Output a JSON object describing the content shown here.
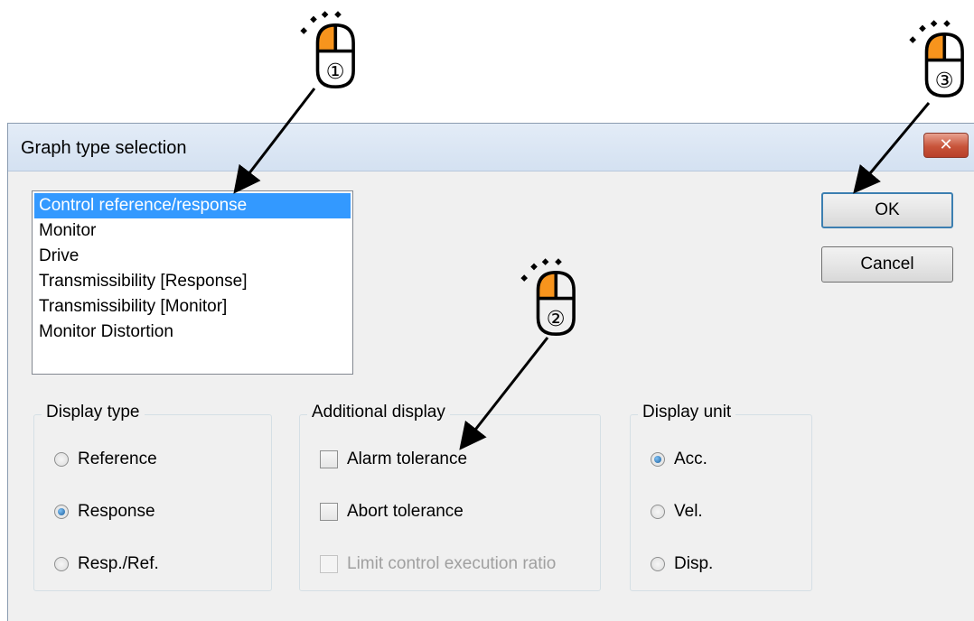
{
  "dialog": {
    "title": "Graph type selection",
    "close_symbol": "✕"
  },
  "graph_types": [
    "Control reference/response",
    "Monitor",
    "Drive",
    "Transmissibility [Response]",
    "Transmissibility [Monitor]",
    "Monitor Distortion"
  ],
  "selected_graph_type": "Control reference/response",
  "buttons": {
    "ok": "OK",
    "cancel": "Cancel"
  },
  "display_type": {
    "label": "Display type",
    "options": [
      "Reference",
      "Response",
      "Resp./Ref."
    ],
    "selected": "Response"
  },
  "additional_display": {
    "label": "Additional display",
    "options": [
      {
        "label": "Alarm tolerance",
        "checked": false,
        "enabled": true
      },
      {
        "label": "Abort tolerance",
        "checked": false,
        "enabled": true
      },
      {
        "label": "Limit control execution ratio",
        "checked": false,
        "enabled": false
      }
    ]
  },
  "display_unit": {
    "label": "Display unit",
    "options": [
      "Acc.",
      "Vel.",
      "Disp."
    ],
    "selected": "Acc."
  },
  "annotations": {
    "step1": "①",
    "step2": "②",
    "step3": "③",
    "mouse_color": "#f7941d"
  }
}
